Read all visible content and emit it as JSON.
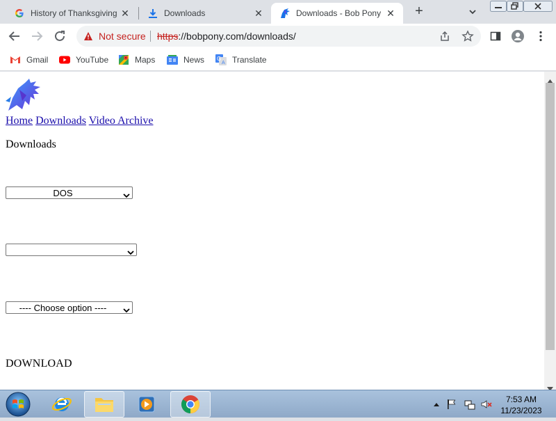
{
  "tabs": [
    {
      "title": "History of Thanksgiving",
      "favicon": "google-g-icon",
      "active": false
    },
    {
      "title": "Downloads",
      "favicon": "download-arrow-icon",
      "active": false
    },
    {
      "title": "Downloads - Bob Pony",
      "favicon": "bob-pony-icon",
      "active": true
    }
  ],
  "address_bar": {
    "security_label": "Not secure",
    "url_scheme": "https",
    "url_rest": "://bobpony.com/downloads/"
  },
  "bookmarks": [
    {
      "label": "Gmail",
      "icon": "gmail-icon"
    },
    {
      "label": "YouTube",
      "icon": "youtube-icon"
    },
    {
      "label": "Maps",
      "icon": "maps-icon"
    },
    {
      "label": "News",
      "icon": "news-icon"
    },
    {
      "label": "Translate",
      "icon": "translate-icon"
    }
  ],
  "page": {
    "nav_links": [
      "Home",
      "Downloads",
      "Video Archive"
    ],
    "heading": "Downloads",
    "select_os": {
      "value": "DOS"
    },
    "select_version": {
      "value": ""
    },
    "select_option": {
      "value": "---- Choose option ----"
    },
    "download_label": "DOWNLOAD"
  },
  "taskbar": {
    "apps": [
      "internet-explorer-icon",
      "file-explorer-icon",
      "media-player-icon",
      "chrome-icon"
    ],
    "active_app": "chrome-icon",
    "time": "7:53 AM",
    "date": "11/23/2023"
  },
  "colors": {
    "tabstrip": "#dee1e6",
    "not_secure_red": "#c5221f",
    "link_blue": "#1a0dab",
    "chrome_blue_accent": "#1a73e8",
    "taskbar": "#9fb8d6"
  }
}
